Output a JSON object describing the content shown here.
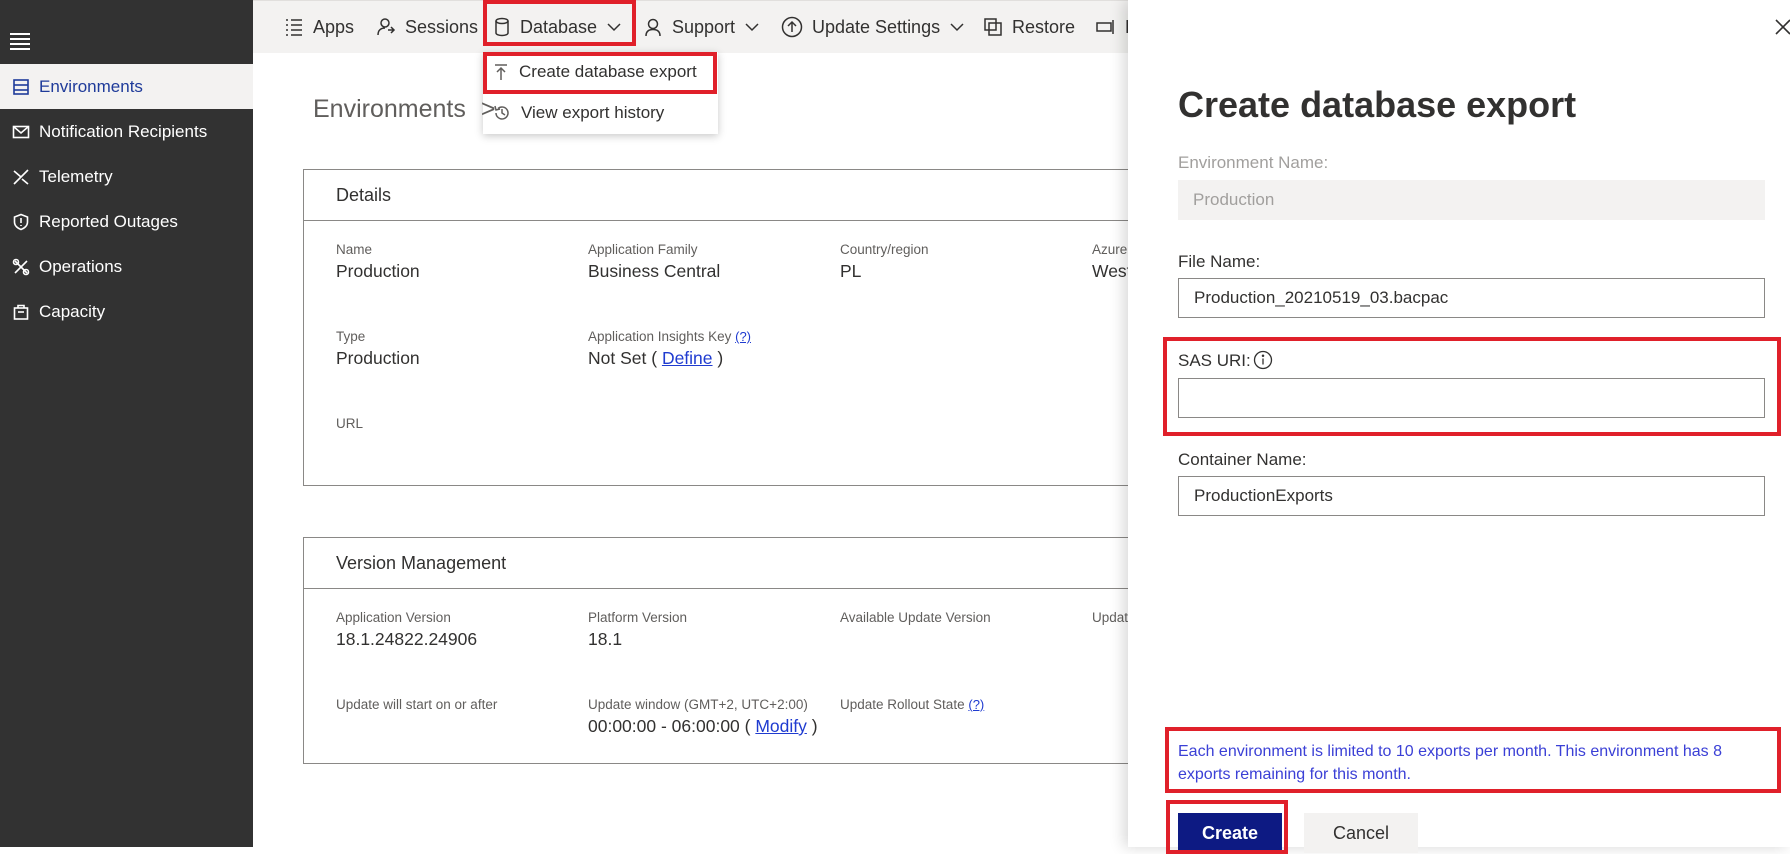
{
  "sidebar": {
    "items": [
      {
        "label": "Environments",
        "icon": "list-icon",
        "active": true
      },
      {
        "label": "Notification Recipients",
        "icon": "mail-icon"
      },
      {
        "label": "Telemetry",
        "icon": "telemetry-icon"
      },
      {
        "label": "Reported Outages",
        "icon": "shield-icon"
      },
      {
        "label": "Operations",
        "icon": "tools-icon"
      },
      {
        "label": "Capacity",
        "icon": "capacity-icon"
      }
    ]
  },
  "topbar": {
    "apps": "Apps",
    "sessions": "Sessions",
    "database": "Database",
    "support": "Support",
    "update_settings": "Update Settings",
    "restore": "Restore",
    "more": "R"
  },
  "dropdown": {
    "create_export": "Create database export",
    "view_history": "View export history"
  },
  "breadcrumb": {
    "root": "Environments",
    "separator": ">"
  },
  "details": {
    "title": "Details",
    "name_label": "Name",
    "name_value": "Production",
    "family_label": "Application Family",
    "family_value": "Business Central",
    "country_label": "Country/region",
    "country_value": "PL",
    "azure_label": "Azure",
    "azure_value": "West",
    "type_label": "Type",
    "type_value": "Production",
    "insights_label": "Application Insights Key",
    "help": "(?)",
    "insights_prefix": "Not Set (",
    "insights_link": "Define",
    "insights_suffix": ")",
    "url_label": "URL"
  },
  "version": {
    "title": "Version Management",
    "app_version_label": "Application Version",
    "app_version_value": "18.1.24822.24906",
    "platform_label": "Platform Version",
    "platform_value": "18.1",
    "available_label": "Available Update Version",
    "update_label": "Updat",
    "start_label": "Update will start on or after",
    "window_label": "Update window (GMT+2, UTC+2:00)",
    "window_prefix": "00:00:00 - 06:00:00 (",
    "window_link": "Modify",
    "window_suffix": ")",
    "rollout_label": "Update Rollout State",
    "help": "(?)"
  },
  "panel": {
    "title": "Create database export",
    "env_label": "Environment Name:",
    "env_value": "Production",
    "file_label": "File Name:",
    "file_value": "Production_20210519_03.bacpac",
    "sas_label": "SAS URI:",
    "sas_value": "",
    "container_label": "Container Name:",
    "container_value": "ProductionExports",
    "note": "Each environment is limited to 10 exports per month. This environment has 8 exports remaining for this month.",
    "create": "Create",
    "cancel": "Cancel"
  },
  "colors": {
    "highlight": "#e0202a",
    "sidebar_bg": "#323232",
    "primary_button": "#0d1a83",
    "note_text": "#3b40d6",
    "link": "#1f3bd0"
  }
}
